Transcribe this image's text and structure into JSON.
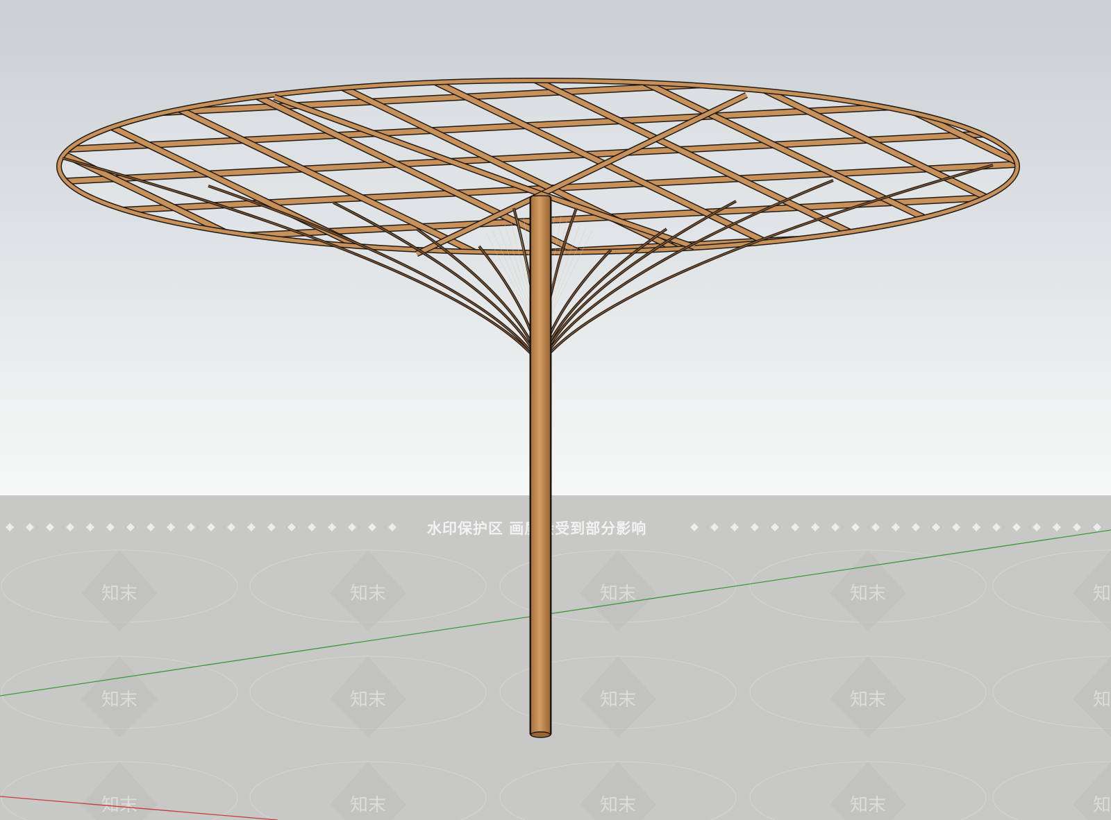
{
  "viewport": {
    "sky_top_color": "#c9cfd3",
    "sky_bottom_color": "#f7f8f8",
    "ground_color": "#c8c8c6",
    "axis_green_color": "#3a9a3a",
    "axis_red_color": "#c83a3a"
  },
  "model": {
    "wood_color": "#c8915a",
    "wood_shadow_color": "#8a5a30",
    "outline_color": "#1e1a16",
    "glass_color": "#e3e7e9"
  },
  "watermark": {
    "banner_text": "水印保护区 画质会受到部分影响",
    "logo_text": "知末"
  }
}
